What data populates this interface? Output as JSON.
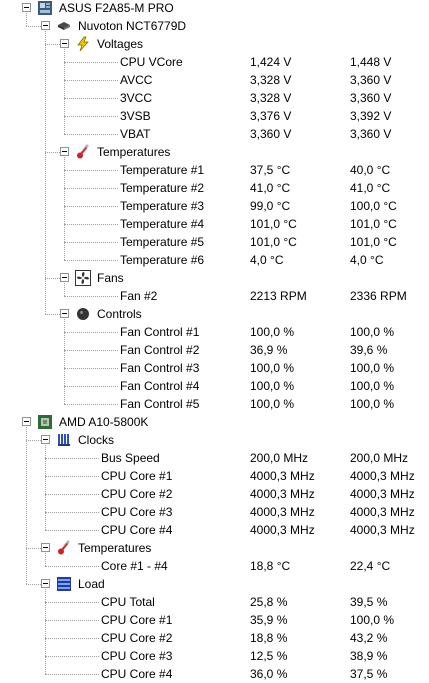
{
  "tree": [
    {
      "level": 0,
      "label": "ASUS F2A85-M PRO",
      "icon": "motherboard-icon",
      "expanded": true
    },
    {
      "level": 1,
      "label": "Nuvoton NCT6779D",
      "icon": "chip-icon",
      "expanded": true
    },
    {
      "level": 2,
      "label": "Voltages",
      "icon": "lightning-icon",
      "expanded": true
    },
    {
      "level": 3,
      "label": "CPU VCore",
      "value": "1,424 V",
      "max": "1,448 V"
    },
    {
      "level": 3,
      "label": "AVCC",
      "value": "3,328 V",
      "max": "3,360 V"
    },
    {
      "level": 3,
      "label": "3VCC",
      "value": "3,328 V",
      "max": "3,360 V"
    },
    {
      "level": 3,
      "label": "3VSB",
      "value": "3,376 V",
      "max": "3,392 V"
    },
    {
      "level": 3,
      "label": "VBAT",
      "value": "3,360 V",
      "max": "3,360 V"
    },
    {
      "level": 2,
      "label": "Temperatures",
      "icon": "thermometer-icon",
      "expanded": true
    },
    {
      "level": 3,
      "label": "Temperature #1",
      "value": "37,5 °C",
      "max": "40,0 °C"
    },
    {
      "level": 3,
      "label": "Temperature #2",
      "value": "41,0 °C",
      "max": "41,0 °C"
    },
    {
      "level": 3,
      "label": "Temperature #3",
      "value": "99,0 °C",
      "max": "100,0 °C"
    },
    {
      "level": 3,
      "label": "Temperature #4",
      "value": "101,0 °C",
      "max": "101,0 °C"
    },
    {
      "level": 3,
      "label": "Temperature #5",
      "value": "101,0 °C",
      "max": "101,0 °C"
    },
    {
      "level": 3,
      "label": "Temperature #6",
      "value": "4,0 °C",
      "max": "4,0 °C"
    },
    {
      "level": 2,
      "label": "Fans",
      "icon": "fan-icon",
      "expanded": true
    },
    {
      "level": 3,
      "label": "Fan #2",
      "value": "2213 RPM",
      "max": "2336 RPM"
    },
    {
      "level": 2,
      "label": "Controls",
      "icon": "control-knob-icon",
      "expanded": true
    },
    {
      "level": 3,
      "label": "Fan Control #1",
      "value": "100,0 %",
      "max": "100,0 %"
    },
    {
      "level": 3,
      "label": "Fan Control #2",
      "value": "36,9 %",
      "max": "39,6 %"
    },
    {
      "level": 3,
      "label": "Fan Control #3",
      "value": "100,0 %",
      "max": "100,0 %"
    },
    {
      "level": 3,
      "label": "Fan Control #4",
      "value": "100,0 %",
      "max": "100,0 %"
    },
    {
      "level": 3,
      "label": "Fan Control #5",
      "value": "100,0 %",
      "max": "100,0 %"
    },
    {
      "level": 0,
      "label": "AMD A10-5800K",
      "icon": "cpu-icon",
      "expanded": true
    },
    {
      "level": 1,
      "label": "Clocks",
      "icon": "clock-bars-icon",
      "expanded": true
    },
    {
      "level": 2,
      "label": "Bus Speed",
      "value": "200,0 MHz",
      "max": "200,0 MHz"
    },
    {
      "level": 2,
      "label": "CPU Core #1",
      "value": "4000,3 MHz",
      "max": "4000,3 MHz"
    },
    {
      "level": 2,
      "label": "CPU Core #2",
      "value": "4000,3 MHz",
      "max": "4000,3 MHz"
    },
    {
      "level": 2,
      "label": "CPU Core #3",
      "value": "4000,3 MHz",
      "max": "4000,3 MHz"
    },
    {
      "level": 2,
      "label": "CPU Core #4",
      "value": "4000,3 MHz",
      "max": "4000,3 MHz"
    },
    {
      "level": 1,
      "label": "Temperatures",
      "icon": "thermometer-icon",
      "expanded": true
    },
    {
      "level": 2,
      "label": "Core #1 - #4",
      "value": "18,8 °C",
      "max": "22,4 °C"
    },
    {
      "level": 1,
      "label": "Load",
      "icon": "load-bars-icon",
      "expanded": true
    },
    {
      "level": 2,
      "label": "CPU Total",
      "value": "25,8 %",
      "max": "39,5 %"
    },
    {
      "level": 2,
      "label": "CPU Core #1",
      "value": "35,9 %",
      "max": "100,0 %"
    },
    {
      "level": 2,
      "label": "CPU Core #2",
      "value": "18,8 %",
      "max": "43,2 %"
    },
    {
      "level": 2,
      "label": "CPU Core #3",
      "value": "12,5 %",
      "max": "38,9 %"
    },
    {
      "level": 2,
      "label": "CPU Core #4",
      "value": "36,0 %",
      "max": "37,5 %"
    }
  ]
}
